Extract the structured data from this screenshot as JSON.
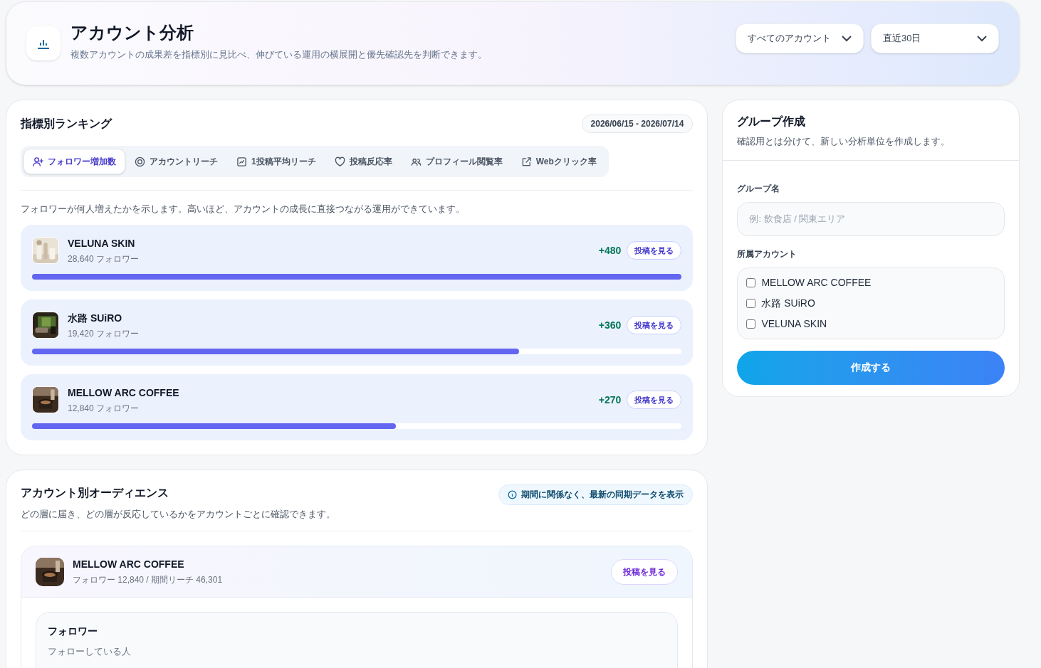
{
  "header": {
    "title": "アカウント分析",
    "subtitle": "複数アカウントの成果差を指標別に見比べ、伸びている運用の横展開と優先確認先を判断できます。",
    "filters": [
      {
        "value": "すべてのアカウント"
      },
      {
        "value": "直近30日"
      }
    ]
  },
  "ranking": {
    "title": "指標別ランキング",
    "period": "2026/06/15 - 2026/07/14",
    "tabs": [
      {
        "label": "フォロワー増加数",
        "selected": true
      },
      {
        "label": "アカウントリーチ",
        "selected": false
      },
      {
        "label": "1投稿平均リーチ",
        "selected": false
      },
      {
        "label": "投稿反応率",
        "selected": false
      },
      {
        "label": "プロフィール閲覧率",
        "selected": false
      },
      {
        "label": "Webクリック率",
        "selected": false
      }
    ],
    "description": "フォロワーが何人増えたかを示します。高いほど、アカウントの成長に直接つながる運用ができています。",
    "rows": [
      {
        "name": "VELUNA SKIN",
        "followers": "28,640 フォロワー",
        "delta": "+480",
        "button": "投稿を見る",
        "level": 1
      },
      {
        "name": "水路 SUiRO",
        "followers": "19,420 フォロワー",
        "delta": "+360",
        "button": "投稿を見る",
        "level": 0.75
      },
      {
        "name": "MELLOW ARC COFFEE",
        "followers": "12,840 フォロワー",
        "delta": "+270",
        "button": "投稿を見る",
        "level": 0.56
      }
    ]
  },
  "audience": {
    "title": "アカウント別オーディエンス",
    "subtitle": "どの層に届き、どの層が反応しているかをアカウントごとに確認できます。",
    "note": "期間に関係なく、最新の同期データを表示",
    "account": {
      "name": "MELLOW ARC COFFEE",
      "meta": "フォロワー 12,840 / 期間リーチ 46,301",
      "button": "投稿を見る",
      "section": {
        "title": "フォロワー",
        "subtitle": "フォローしている人"
      }
    }
  },
  "group": {
    "title": "グループ作成",
    "subtitle": "確認用とは分けて、新しい分析単位を作成します。",
    "name_label": "グループ名",
    "name_placeholder": "例: 飲食店 / 関東エリア",
    "accounts_label": "所属アカウント",
    "accounts": [
      {
        "label": "MELLOW ARC COFFEE",
        "checked": false
      },
      {
        "label": "水路 SUiRO",
        "checked": false
      },
      {
        "label": "VELUNA SKIN",
        "checked": false
      }
    ],
    "submit": "作成する"
  }
}
